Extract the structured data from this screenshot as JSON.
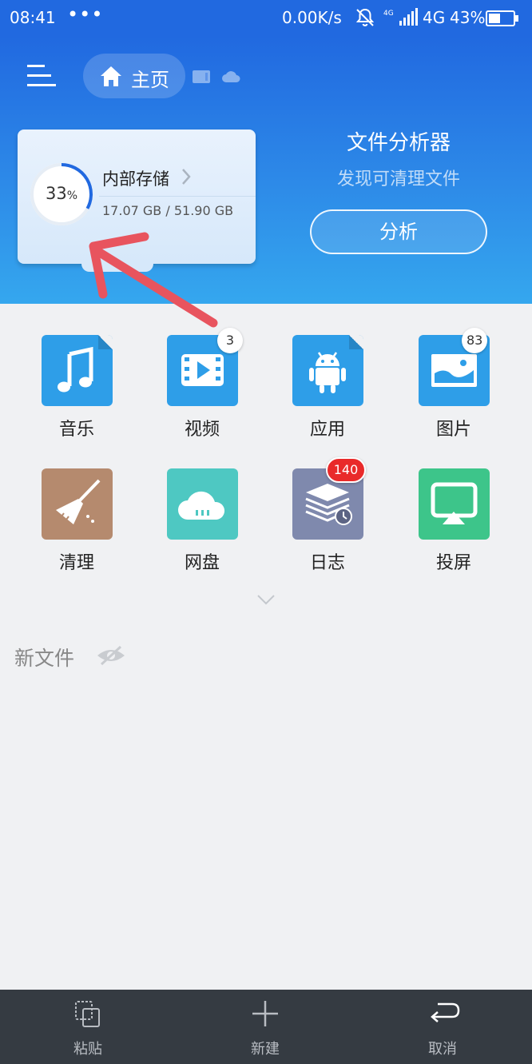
{
  "status_bar": {
    "time": "08:41",
    "dots": "•••",
    "net_speed": "0.00K/s",
    "signal": "4G",
    "network": "4G",
    "battery": "43%"
  },
  "header": {
    "home_label": "主页"
  },
  "storage": {
    "title": "内部存储",
    "percent": "33",
    "percent_sign": "%",
    "used_fraction": 0.33,
    "size": "17.07 GB / 51.90 GB"
  },
  "analyzer": {
    "title": "文件分析器",
    "subtitle": "发现可清理文件",
    "button": "分析"
  },
  "categories": [
    {
      "label": "音乐",
      "icon": "music-icon",
      "color": "#2e9ee8",
      "badge": ""
    },
    {
      "label": "视频",
      "icon": "video-icon",
      "color": "#2e9ee8",
      "badge": "3"
    },
    {
      "label": "应用",
      "icon": "android-icon",
      "color": "#2e9ee8",
      "badge": ""
    },
    {
      "label": "图片",
      "icon": "image-icon",
      "color": "#2e9ee8",
      "badge": "83"
    },
    {
      "label": "清理",
      "icon": "broom-icon",
      "color": "#b58a6e",
      "badge": ""
    },
    {
      "label": "网盘",
      "icon": "cloud-icon",
      "color": "#4ec8c2",
      "badge": ""
    },
    {
      "label": "日志",
      "icon": "log-icon",
      "color": "#7f89ad",
      "badge": "140"
    },
    {
      "label": "投屏",
      "icon": "cast-icon",
      "color": "#3dc58a",
      "badge": ""
    }
  ],
  "new_files": {
    "label": "新文件"
  },
  "bottom_bar": {
    "paste": "粘贴",
    "new": "新建",
    "cancel": "取消"
  }
}
